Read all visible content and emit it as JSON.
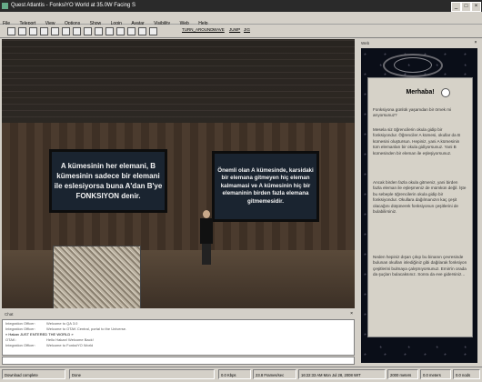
{
  "window": {
    "title": "Quest Atlantis - FonksiYO World at 35.0W Facing S"
  },
  "menu": [
    "File",
    "Teleport",
    "View",
    "Options",
    "Show",
    "Login",
    "Avatar",
    "Visibility",
    "Web",
    "Help"
  ],
  "toolbar": {
    "links": [
      "TURN_AROUND",
      "WAVE",
      "JUMP",
      "JIG"
    ]
  },
  "scene": {
    "sign_left": "A kümesinin her elemani, B kümesinin sadece bir elemani ile eslesiyorsa buna A'dan B'ye FONKSIYON denir.",
    "sign_right": "Önemli olan A kümesinde, karsidaki bir elemana gitmeyen hiç eleman kalmamasi ve A kümesinin hiç bir elemaninin birden fazla elemana gitmemesidir."
  },
  "web": {
    "title": "Web",
    "greeting": "Merhaba!",
    "paragraphs": [
      "Fonksiyona günlük yaşamdan bir örnek mi arıyorsunuz?",
      "Mesela siz öğrencilerin okula gidip bir fonksiyondur. Öğrenciler A kümesi, okullar da B kümesini oluştursun. Hepiniz, yani A kümesinin tüm elemanları bir okula gidiyorsunuz. Yani B kümesinden bir eleman ile eşleşiyorsunuz.",
      "Ancak birden fazla okula gitmeniz, yani birden fazla eleman ile eşleşmeniz de mümkün değil. İşte bu sebeple öğrencilerin okula gidip bir fonksiyondur. Okullara dağılmanızın kaç çeşit olacağını düşünerek fonksiyonun çeşitlerini de bulabilirsiniz.",
      "Neden hepiniz dışarı çıkıp bu binanın çevresinde bulunan okulları inlediğiniz gibi dağılarak fonksiyon çeşitlerini bulmaya çalışmıyorsunuz. Emin'in orada da şuçları bulacaksınız. Sonra da eve gidersiniz..."
    ]
  },
  "chat": {
    "title": "Chat",
    "lines": [
      {
        "speaker": "Integration Officer:",
        "text": "Welcome to QA 3.0"
      },
      {
        "speaker": "Integration Officer:",
        "text": "Welcome to OTAK Central, portal to the Universe."
      },
      {
        "speaker": "",
        "text": "« Hakan JUST ENTERED THE WORLD »"
      },
      {
        "speaker": "OTAK:",
        "text": "Hello Hakan! Welcome Back!"
      },
      {
        "speaker": "Integration Officer:",
        "text": "Welcome to FonksiYO World"
      }
    ]
  },
  "status": {
    "left": "Download complete",
    "done": "Done",
    "kbps": "0.0 Kbps",
    "fps": "23.8 Frames/sec",
    "time": "16:22:33 AM Mon Jul 28, 2008 WIT",
    "meters": "2000 meters",
    "kmeters": "0.0 meters",
    "nodes": "0.0 nods"
  },
  "colors": {
    "sign_bg": "#1a2430",
    "titlebar": "#2a2a2a",
    "chrome": "#d4d0c8"
  }
}
